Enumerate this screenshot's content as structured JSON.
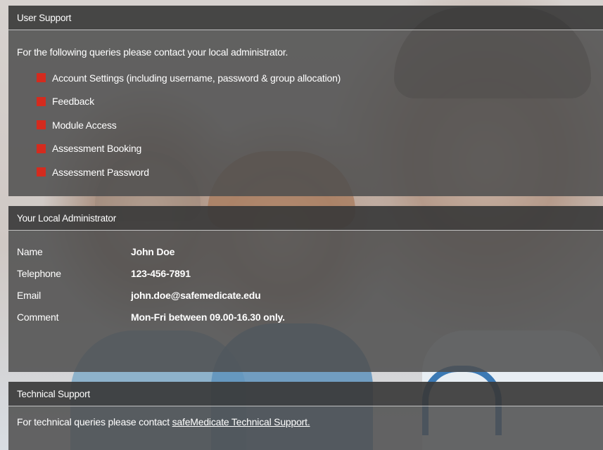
{
  "user_support": {
    "title": "User Support",
    "intro": "For the following queries please contact your local administrator.",
    "items": [
      {
        "label": "Account Settings (including username, password & group allocation)"
      },
      {
        "label": "Feedback"
      },
      {
        "label": "Module Access"
      },
      {
        "label": "Assessment Booking"
      },
      {
        "label": "Assessment Password"
      }
    ],
    "bullet_color": "#d42b1e"
  },
  "local_admin": {
    "title": "Your Local Administrator",
    "rows": [
      {
        "label": "Name",
        "value": "John Doe"
      },
      {
        "label": "Telephone",
        "value": "123-456-7891"
      },
      {
        "label": "Email",
        "value": "john.doe@safemedicate.edu"
      },
      {
        "label": "Comment",
        "value": "Mon-Fri between 09.00-16.30 only."
      }
    ]
  },
  "tech_support": {
    "title": "Technical Support",
    "text": "For technical queries please contact ",
    "link_text": "safeMedicate Technical Support."
  }
}
